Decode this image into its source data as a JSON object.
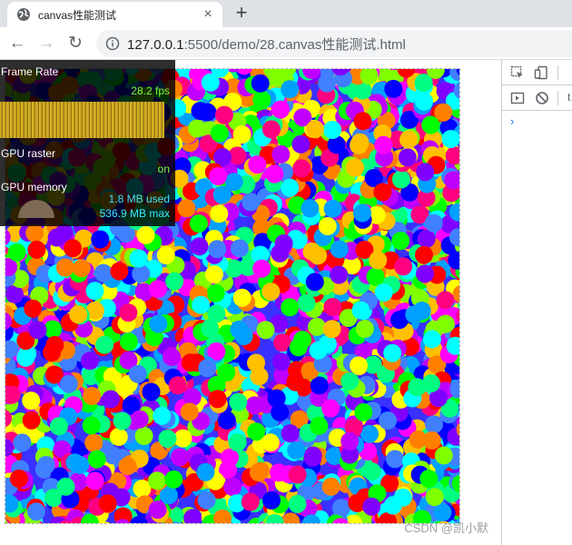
{
  "browser": {
    "tab_title": "canvas性能测试",
    "tab_close": "×",
    "new_tab": "+",
    "nav": {
      "back": "←",
      "forward": "→",
      "reload": "↻"
    },
    "url_host": "127.0.0.1",
    "url_path": ":5500/demo/28.canvas性能测试.html"
  },
  "hud": {
    "frame_rate_label": "Frame Rate",
    "frame_rate_value": "28.2 fps",
    "gpu_raster_label": "GPU raster",
    "gpu_raster_value": "on",
    "gpu_memory_label": "GPU memory",
    "gpu_memory_used": "1.8 MB used",
    "gpu_memory_max": "536.9 MB max"
  },
  "devtools": {
    "cut_tab_text": "t",
    "prompt": "›"
  },
  "watermark": "CSDN @凯小默",
  "colors": {
    "hud_green": "#7cfc3a",
    "hud_cyan": "#3fe6ff",
    "circle_palette": [
      "#ff0000",
      "#ff00ff",
      "#00ff00",
      "#0000ff",
      "#00ffff",
      "#ffff00",
      "#ff8000",
      "#8000ff",
      "#80ff00",
      "#00a0ff",
      "#ff0080",
      "#00ff80",
      "#c000ff",
      "#ffc000",
      "#4080ff"
    ]
  }
}
